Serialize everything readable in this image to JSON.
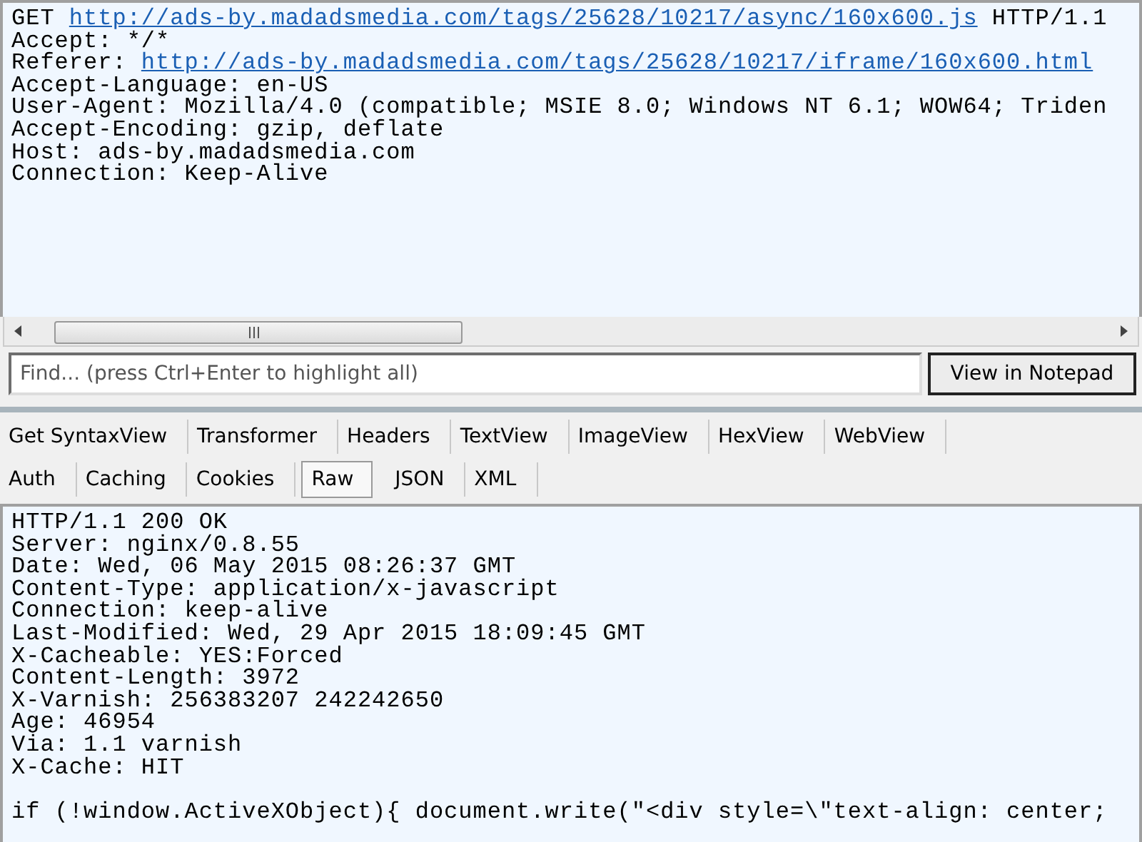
{
  "request": {
    "lines": [
      {
        "text": "GET ",
        "link": "http://ads-by.madadsmedia.com/tags/25628/10217/async/160x600.js",
        "suffix": " HTTP/1.1"
      },
      {
        "text": "Accept: */*"
      },
      {
        "text": "Referer: ",
        "link": "http://ads-by.madadsmedia.com/tags/25628/10217/iframe/160x600.html"
      },
      {
        "text": "Accept-Language: en-US"
      },
      {
        "text": "User-Agent: Mozilla/4.0 (compatible; MSIE 8.0; Windows NT 6.1; WOW64; Triden"
      },
      {
        "text": "Accept-Encoding: gzip, deflate"
      },
      {
        "text": "Host: ads-by.madadsmedia.com"
      },
      {
        "text": "Connection: Keep-Alive"
      }
    ]
  },
  "find": {
    "placeholder": "Find... (press Ctrl+Enter to highlight all)",
    "button": "View in Notepad"
  },
  "tab_rows": [
    [
      {
        "label": "Get SyntaxView",
        "selected": false
      },
      {
        "label": "Transformer",
        "selected": false
      },
      {
        "label": "Headers",
        "selected": false
      },
      {
        "label": "TextView",
        "selected": false
      },
      {
        "label": "ImageView",
        "selected": false
      },
      {
        "label": "HexView",
        "selected": false
      },
      {
        "label": "WebView",
        "selected": false
      }
    ],
    [
      {
        "label": "Auth",
        "selected": false
      },
      {
        "label": "Caching",
        "selected": false
      },
      {
        "label": "Cookies",
        "selected": false
      },
      {
        "label": "Raw",
        "selected": true
      },
      {
        "label": "JSON",
        "selected": false
      },
      {
        "label": "XML",
        "selected": false
      }
    ]
  ],
  "response": {
    "headers": [
      "HTTP/1.1 200 OK",
      "Server: nginx/0.8.55",
      "Date: Wed, 06 May 2015 08:26:37 GMT",
      "Content-Type: application/x-javascript",
      "Connection: keep-alive",
      "Last-Modified: Wed, 29 Apr 2015 18:09:45 GMT",
      "X-Cacheable: YES:Forced",
      "Content-Length: 3972",
      "X-Varnish: 256383207 242242650",
      "Age: 46954",
      "Via: 1.1 varnish",
      "X-Cache: HIT"
    ],
    "body": [
      "if (!window.ActiveXObject){ document.write(\"<div style=\\\"text-align: center;"
    ]
  }
}
